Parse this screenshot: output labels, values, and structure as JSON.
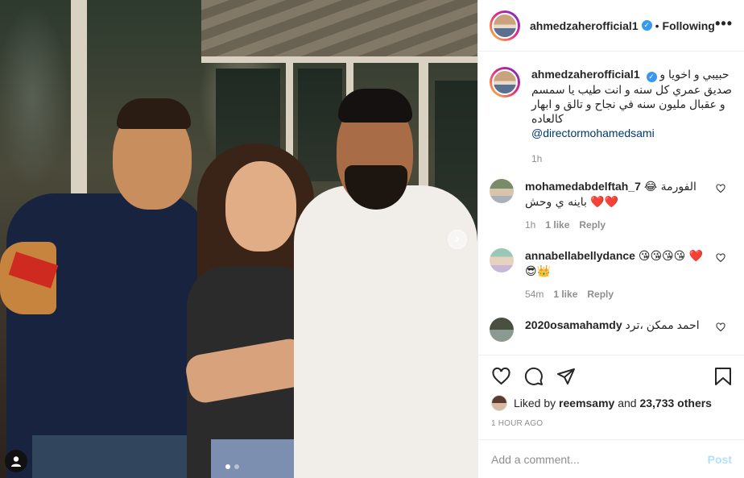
{
  "post": {
    "author": "ahmedzaherofficial1",
    "follow_separator": "•",
    "follow_status": "Following",
    "more_glyph": "•••",
    "verified_glyph": "✓"
  },
  "photo": {
    "carousel_next_glyph": "›",
    "dots": 2,
    "active_dot": 0
  },
  "caption": {
    "author": "ahmedzaherofficial1",
    "text": "حبيبي و اخويا و صديق عمري كل سنه و انت طيب يا سمسم و عقبال مليون سنه في نجاح و تالق و ابهار كالعاده",
    "mention": "@directormohamedsami",
    "time": "1h"
  },
  "comments": [
    {
      "author": "mohamedabdelftah_7",
      "text": "الفورمة 😂❤️❤️ باينه ي وحش",
      "time": "1h",
      "likes": "1 like",
      "reply": "Reply"
    },
    {
      "author": "annabellabellydance",
      "text": "😘😘😘😘 ❤️😎👑",
      "time": "54m",
      "likes": "1 like",
      "reply": "Reply"
    },
    {
      "author": "2020osamahamdy",
      "text": "احمد ممكن ،ترد"
    }
  ],
  "engagement": {
    "liked_by_prefix": "Liked by",
    "liked_by_user": "reemsamy",
    "liked_by_and": "and",
    "others_count": "23,733 others",
    "timestamp": "1 HOUR AGO"
  },
  "composer": {
    "placeholder": "Add a comment...",
    "post_label": "Post"
  },
  "colors": {
    "verified": "#3897f0",
    "mention": "#00376b",
    "post_disabled": "#b2dffc",
    "heart_red": "#ed4956"
  }
}
